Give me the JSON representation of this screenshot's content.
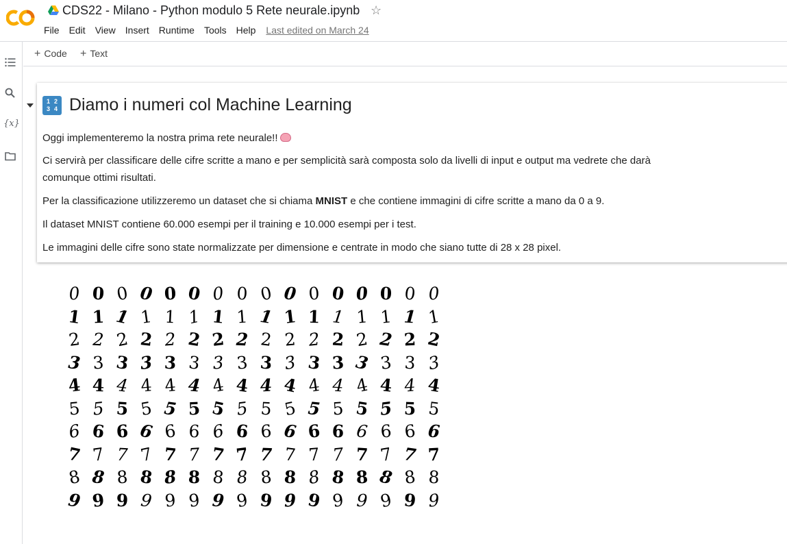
{
  "header": {
    "title": "CDS22 - Milano - Python modulo 5 Rete neurale.ipynb",
    "menu": [
      "File",
      "Edit",
      "View",
      "Insert",
      "Runtime",
      "Tools",
      "Help"
    ],
    "last_edited": "Last edited on March 24",
    "logo_text": "CO"
  },
  "toolbar": {
    "code_label": "Code",
    "text_label": "Text"
  },
  "sidebar": {
    "variables_label": "{x}"
  },
  "cell": {
    "heading": "Diamo i numeri col Machine Learning",
    "heading_icon_digits": [
      "1",
      "2",
      "3",
      "4"
    ],
    "p1": "Oggi implementeremo la nostra prima rete neurale!!",
    "p2": "Ci servirà per classificare delle cifre scritte a mano e per semplicità sarà composta solo da livelli di input e output ma vedrete che darà comunque ottimi risultati.",
    "p3_before": "Per la classificazione utilizzeremo un dataset che si chiama ",
    "p3_bold": "MNIST",
    "p3_after": " e che contiene immagini di cifre scritte a mano da 0 a 9.",
    "p4": "Il dataset MNIST contiene 60.000 esempi per il training e 10.000 esempi per i test.",
    "p5": "Le immagini delle cifre sono state normalizzate per dimensione e centrate in modo che siano tutte di 28 x 28 pixel."
  },
  "digits_image": {
    "rows": [
      [
        "0",
        "0",
        "0",
        "0",
        "0",
        "0",
        "0",
        "0",
        "0",
        "0",
        "0",
        "0",
        "0",
        "0",
        "0",
        "0"
      ],
      [
        "1",
        "1",
        "1",
        "1",
        "1",
        "1",
        "1",
        "1",
        "1",
        "1",
        "1",
        "1",
        "1",
        "1",
        "1",
        "1"
      ],
      [
        "2",
        "2",
        "2",
        "2",
        "2",
        "2",
        "2",
        "2",
        "2",
        "2",
        "2",
        "2",
        "2",
        "2",
        "2",
        "2"
      ],
      [
        "3",
        "3",
        "3",
        "3",
        "3",
        "3",
        "3",
        "3",
        "3",
        "3",
        "3",
        "3",
        "3",
        "3",
        "3",
        "3"
      ],
      [
        "4",
        "4",
        "4",
        "4",
        "4",
        "4",
        "4",
        "4",
        "4",
        "4",
        "4",
        "4",
        "4",
        "4",
        "4",
        "4"
      ],
      [
        "5",
        "5",
        "5",
        "5",
        "5",
        "5",
        "5",
        "5",
        "5",
        "5",
        "5",
        "5",
        "5",
        "5",
        "5",
        "5"
      ],
      [
        "6",
        "6",
        "6",
        "6",
        "6",
        "6",
        "6",
        "6",
        "6",
        "6",
        "6",
        "6",
        "6",
        "6",
        "6",
        "6"
      ],
      [
        "7",
        "7",
        "7",
        "7",
        "7",
        "7",
        "7",
        "7",
        "7",
        "7",
        "7",
        "7",
        "7",
        "7",
        "7",
        "7"
      ],
      [
        "8",
        "8",
        "8",
        "8",
        "8",
        "8",
        "8",
        "8",
        "8",
        "8",
        "8",
        "8",
        "8",
        "8",
        "8",
        "8"
      ],
      [
        "9",
        "9",
        "9",
        "9",
        "9",
        "9",
        "9",
        "9",
        "9",
        "9",
        "9",
        "9",
        "9",
        "9",
        "9",
        "9"
      ]
    ]
  },
  "colors": {
    "logo_orange": "#f9ab00",
    "logo_dark_orange": "#e8710a",
    "heading_icon": "#3b88c3"
  }
}
